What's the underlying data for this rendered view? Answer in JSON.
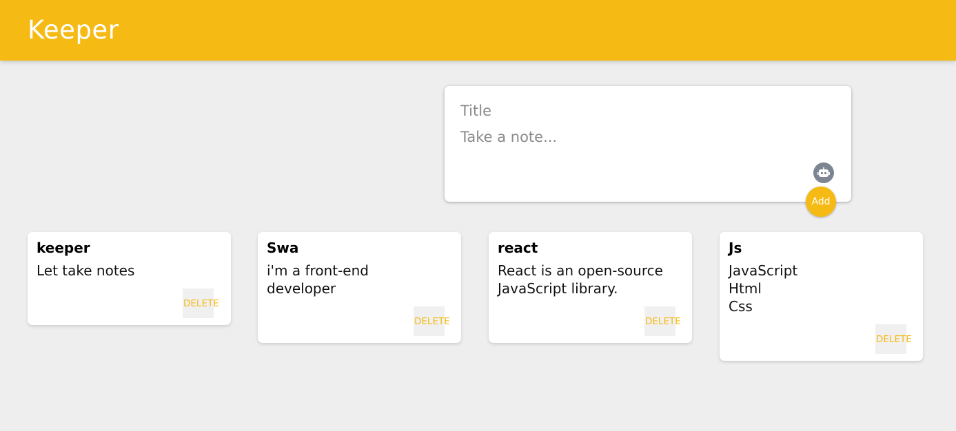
{
  "header": {
    "title": "Keeper"
  },
  "create": {
    "title_placeholder": "Title",
    "content_placeholder": "Take a note...",
    "extension_icon": "robot-icon",
    "add_label": "Add"
  },
  "notes": [
    {
      "title": "keeper",
      "content": "Let take notes",
      "delete_label": "DELETE"
    },
    {
      "title": "Swa",
      "content": "i'm a front-end\ndeveloper",
      "delete_label": "DELETE"
    },
    {
      "title": "react",
      "content": "React is an open-source\nJavaScript library.",
      "delete_label": "DELETE"
    },
    {
      "title": "Js",
      "content": "JavaScript\nHtml\nCss",
      "delete_label": "DELETE"
    }
  ],
  "colors": {
    "accent": "#f5ba13",
    "background": "#eeeeee",
    "card": "#ffffff",
    "extension_icon": "#7d8593"
  }
}
